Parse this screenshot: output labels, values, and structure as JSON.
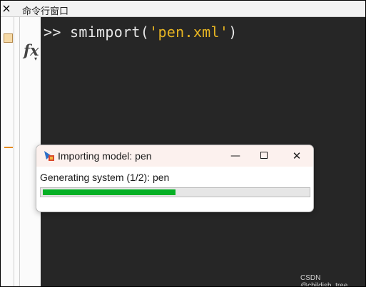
{
  "window": {
    "title": "命令行窗口",
    "close_glyph": "×"
  },
  "gutter": {
    "fx_label": "fx",
    "fx_caret": "▾"
  },
  "command": {
    "prompt": ">> ",
    "text_prefix": "smimport(",
    "text_string": "'pen.xml'",
    "text_suffix": ")"
  },
  "dialog": {
    "title": "Importing model: pen",
    "status": "Generating system (1/2): pen",
    "progress": 0.5,
    "minimize_glyph": "—",
    "close_glyph": "✕",
    "icon": "simscape-import-icon"
  },
  "colors": {
    "editor_background": "#262626",
    "string_literal": "#e6b422",
    "progress_fill": "#06b025"
  },
  "watermark": "CSDN @childish_tree"
}
